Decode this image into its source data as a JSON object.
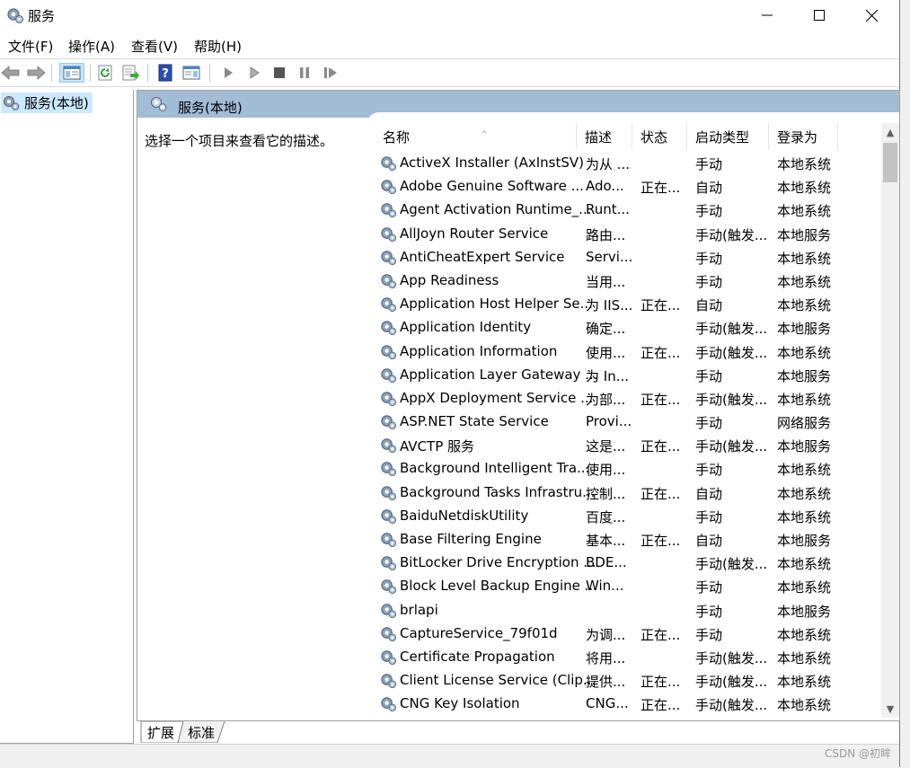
{
  "window": {
    "title": "服务",
    "watermark": "CSDN @初眸"
  },
  "menu": [
    "文件(F)",
    "操作(A)",
    "查看(V)",
    "帮助(H)"
  ],
  "tree": {
    "root_label": "服务(本地)"
  },
  "pane": {
    "title": "服务(本地)",
    "description": "选择一个项目来查看它的描述。"
  },
  "columns": [
    "名称",
    "描述",
    "状态",
    "启动类型",
    "登录为"
  ],
  "rows": [
    {
      "name": "ActiveX Installer (AxInstSV)",
      "desc": "为从 ...",
      "status": "",
      "start": "手动",
      "logon": "本地系统"
    },
    {
      "name": "Adobe Genuine Software ...",
      "desc": "Ado...",
      "status": "正在...",
      "start": "自动",
      "logon": "本地系统"
    },
    {
      "name": "Agent Activation Runtime_...",
      "desc": "Runt...",
      "status": "",
      "start": "手动",
      "logon": "本地系统"
    },
    {
      "name": "AllJoyn Router Service",
      "desc": "路由...",
      "status": "",
      "start": "手动(触发...",
      "logon": "本地服务"
    },
    {
      "name": "AntiCheatExpert Service",
      "desc": "Servi...",
      "status": "",
      "start": "手动",
      "logon": "本地系统"
    },
    {
      "name": "App Readiness",
      "desc": "当用...",
      "status": "",
      "start": "手动",
      "logon": "本地系统"
    },
    {
      "name": "Application Host Helper Se...",
      "desc": "为 IIS...",
      "status": "正在...",
      "start": "自动",
      "logon": "本地系统"
    },
    {
      "name": "Application Identity",
      "desc": "确定...",
      "status": "",
      "start": "手动(触发...",
      "logon": "本地服务"
    },
    {
      "name": "Application Information",
      "desc": "使用...",
      "status": "正在...",
      "start": "手动(触发...",
      "logon": "本地系统"
    },
    {
      "name": "Application Layer Gateway ...",
      "desc": "为 In...",
      "status": "",
      "start": "手动",
      "logon": "本地服务"
    },
    {
      "name": "AppX Deployment Service ...",
      "desc": "为部...",
      "status": "正在...",
      "start": "手动(触发...",
      "logon": "本地系统"
    },
    {
      "name": "ASP.NET State Service",
      "desc": "Provi...",
      "status": "",
      "start": "手动",
      "logon": "网络服务"
    },
    {
      "name": "AVCTP 服务",
      "desc": "这是...",
      "status": "正在...",
      "start": "手动(触发...",
      "logon": "本地服务"
    },
    {
      "name": "Background Intelligent Tra...",
      "desc": "使用...",
      "status": "",
      "start": "手动",
      "logon": "本地系统"
    },
    {
      "name": "Background Tasks Infrastru...",
      "desc": "控制...",
      "status": "正在...",
      "start": "自动",
      "logon": "本地系统"
    },
    {
      "name": "BaiduNetdiskUtility",
      "desc": "百度...",
      "status": "",
      "start": "手动",
      "logon": "本地系统"
    },
    {
      "name": "Base Filtering Engine",
      "desc": "基本...",
      "status": "正在...",
      "start": "自动",
      "logon": "本地服务"
    },
    {
      "name": "BitLocker Drive Encryption ...",
      "desc": "BDE...",
      "status": "",
      "start": "手动(触发...",
      "logon": "本地系统"
    },
    {
      "name": "Block Level Backup Engine ...",
      "desc": "Win...",
      "status": "",
      "start": "手动",
      "logon": "本地系统"
    },
    {
      "name": "brlapi",
      "desc": "",
      "status": "",
      "start": "手动",
      "logon": "本地服务"
    },
    {
      "name": "CaptureService_79f01d",
      "desc": "为调...",
      "status": "正在...",
      "start": "手动",
      "logon": "本地系统"
    },
    {
      "name": "Certificate Propagation",
      "desc": "将用...",
      "status": "",
      "start": "手动(触发...",
      "logon": "本地系统"
    },
    {
      "name": "Client License Service (Clip...",
      "desc": "提供...",
      "status": "正在...",
      "start": "手动(触发...",
      "logon": "本地系统"
    },
    {
      "name": "CNG Key Isolation",
      "desc": "CNG...",
      "status": "正在...",
      "start": "手动(触发...",
      "logon": "本地系统"
    }
  ],
  "tabs": [
    "扩展",
    "标准"
  ],
  "colors": {
    "header_bar": "#a3bcd6",
    "tree_selection": "#cce8ff"
  }
}
